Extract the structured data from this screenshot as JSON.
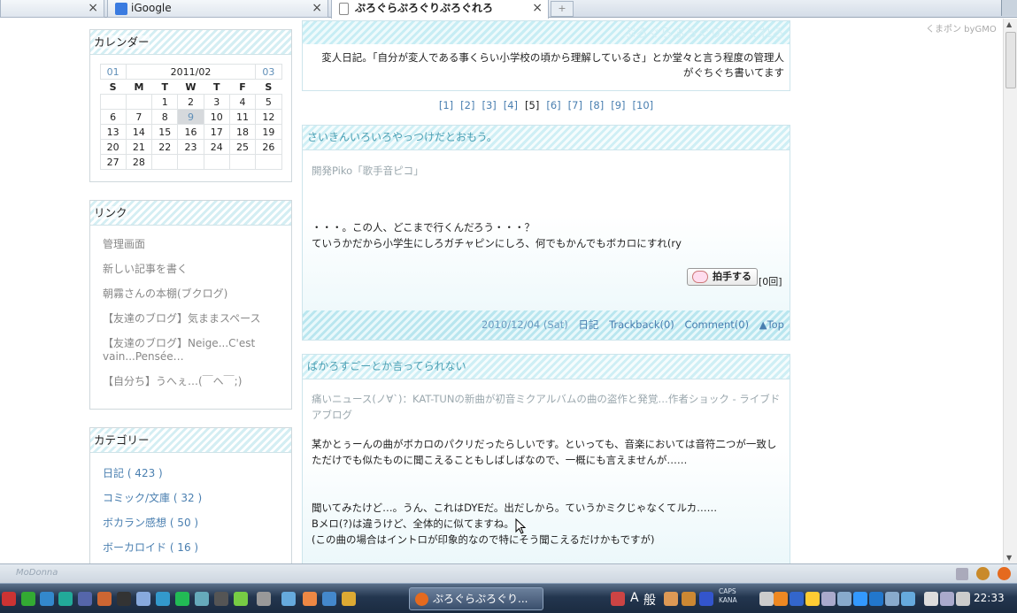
{
  "browser": {
    "tabs": [
      {
        "label": ""
      },
      {
        "label": "iGoogle"
      },
      {
        "label": "ぷろぐらぷろぐりぷろぐれろ"
      }
    ],
    "close_glyph": "×",
    "new_tab_glyph": "+"
  },
  "header": {
    "site_title": "ぷろぐらぷろぐりぷろぐれろ",
    "description": "変人日記。「自分が変人である事くらい小学校の頃から理解しているさ」とか堂々と言う程度の管理人がぐちぐち書いてます"
  },
  "kumapon": "くまポン byGMO",
  "calendar": {
    "title": "カレンダー",
    "prev": "01",
    "month": "2011/02",
    "next": "03",
    "weekdays": [
      "S",
      "M",
      "T",
      "W",
      "T",
      "F",
      "S"
    ],
    "weeks": [
      [
        "",
        "",
        "1",
        "2",
        "3",
        "4",
        "5"
      ],
      [
        "6",
        "7",
        "8",
        "9",
        "10",
        "11",
        "12"
      ],
      [
        "13",
        "14",
        "15",
        "16",
        "17",
        "18",
        "19"
      ],
      [
        "20",
        "21",
        "22",
        "23",
        "24",
        "25",
        "26"
      ],
      [
        "27",
        "28",
        "",
        "",
        "",
        "",
        ""
      ]
    ],
    "today": "9"
  },
  "links": {
    "title": "リンク",
    "items": [
      "管理画面",
      "新しい記事を書く",
      "朝霧さんの本棚(ブクログ)",
      "【友達のブログ】気ままスペース",
      "【友達のブログ】Neige...C'est vain...Pensée…",
      "【自分ち】うへぇ…(￣ヘ￣;)"
    ]
  },
  "categories": {
    "title": "カテゴリー",
    "items": [
      "日記 ( 423 )",
      "コミック/文庫 ( 32 )",
      "ボカラン感想 ( 50 )",
      "ボーカロイド ( 16 )"
    ]
  },
  "pager": {
    "pages": [
      "[1]",
      "[2]",
      "[3]",
      "[4]",
      "[5]",
      "[6]",
      "[7]",
      "[8]",
      "[9]",
      "[10]"
    ],
    "current": "[5]"
  },
  "entries": [
    {
      "title": "さいきんいろいろやっつけだとおもう。",
      "ref": "開発Piko「歌手音ピコ」",
      "lines": [
        "・・・。この人、どこまで行くんだろう・・・？",
        "ていうかだから小学生にしろガチャピンにしろ、何でもかんでもボカロにすれ(ry"
      ],
      "clap_label": "拍手する",
      "clap_count": "[0回]",
      "footer": {
        "date": "2010/12/04 (Sat)",
        "category": "日記",
        "trackback": "Trackback(0)",
        "comment": "Comment(0)",
        "top": "▲Top"
      }
    },
    {
      "title": "ぱかろすごーとか言ってられない",
      "ref": "痛いニュース(ノ∀`)：KAT-TUNの新曲が初音ミクアルバムの曲の盗作と発覚…作者ショック - ライブドアブログ",
      "lines": [
        "某かとぅーんの曲がボカロのパクリだったらしいです。といっても、音楽においては音符二つが一致しただけでも似たものに聞こえることもしばしばなので、一概にも言えませんが……",
        "",
        "聞いてみたけど…。うん、これはDYEだ。出だしから。ていうかミクじゃなくてルカ……",
        "Bメロ(?)は違うけど、全体的に似てますね。",
        "(この曲の場合はイントロが印象的なので特にそう聞こえるだけかもですが)"
      ]
    }
  ],
  "statusbar": {
    "text": "MoDonna"
  },
  "taskbar": {
    "task_label": "ぷろぐらぷろぐり...",
    "ime_a": "A",
    "ime_mode": "般",
    "caps": "CAPS",
    "kana": "KANA",
    "clock": "22:33"
  }
}
